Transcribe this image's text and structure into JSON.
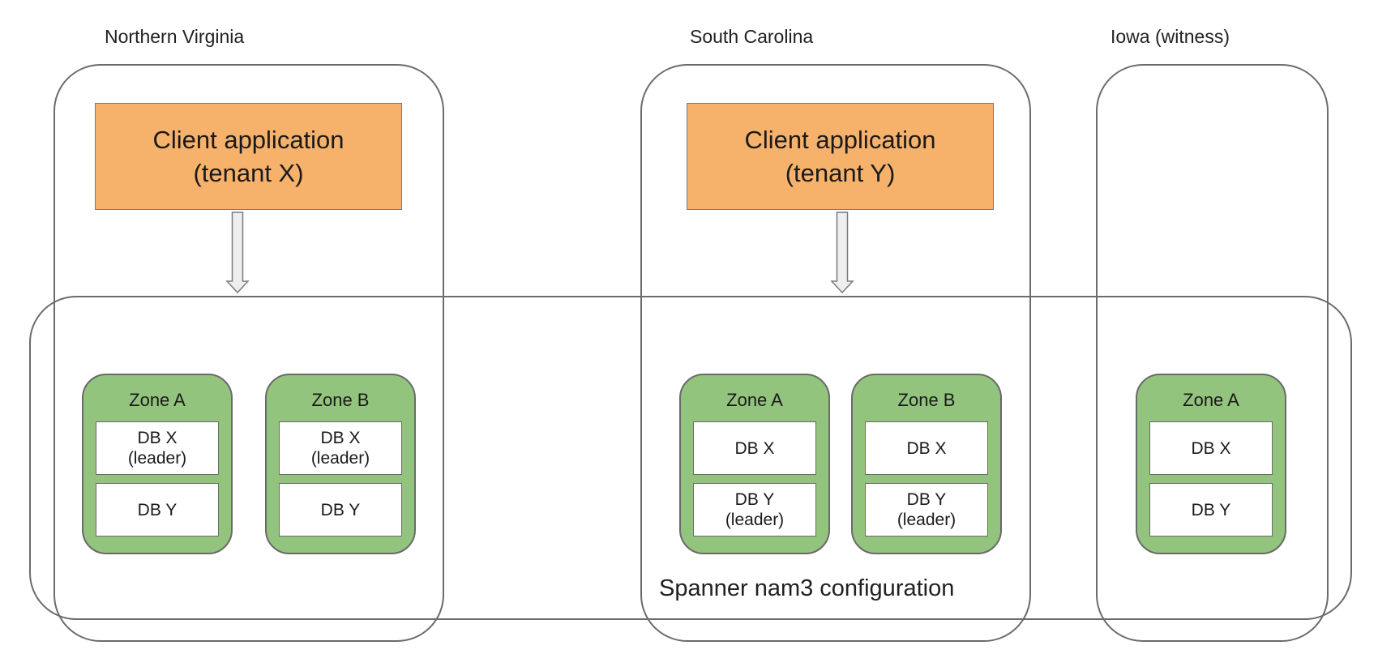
{
  "regions": [
    {
      "label": "Northern Virginia"
    },
    {
      "label": "South Carolina"
    },
    {
      "label": "Iowa (witness)"
    }
  ],
  "clients": [
    {
      "line1": "Client application",
      "line2": "(tenant X)"
    },
    {
      "line1": "Client application",
      "line2": "(tenant Y)"
    }
  ],
  "configuration_label": "Spanner nam3 configuration",
  "zones": [
    {
      "title": "Zone A",
      "db_top": {
        "name": "DB X",
        "note": "(leader)"
      },
      "db_bottom": {
        "name": "DB Y",
        "note": ""
      }
    },
    {
      "title": "Zone B",
      "db_top": {
        "name": "DB X",
        "note": "(leader)"
      },
      "db_bottom": {
        "name": "DB Y",
        "note": ""
      }
    },
    {
      "title": "Zone A",
      "db_top": {
        "name": "DB X",
        "note": ""
      },
      "db_bottom": {
        "name": "DB Y",
        "note": "(leader)"
      }
    },
    {
      "title": "Zone B",
      "db_top": {
        "name": "DB X",
        "note": ""
      },
      "db_bottom": {
        "name": "DB Y",
        "note": "(leader)"
      }
    },
    {
      "title": "Zone A",
      "db_top": {
        "name": "DB X",
        "note": ""
      },
      "db_bottom": {
        "name": "DB Y",
        "note": ""
      }
    }
  ],
  "colors": {
    "client_fill": "#f6b26b",
    "zone_fill": "#93c47d",
    "border": "#6b6b6b",
    "arrow_fill": "#eeeeee"
  }
}
